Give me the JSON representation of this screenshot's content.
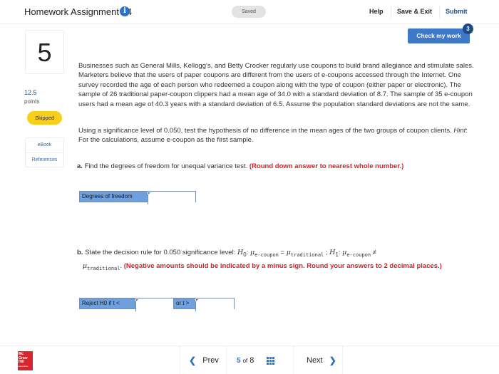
{
  "header": {
    "title": "Homework Assignment #4",
    "info_icon": "i",
    "saved_label": "Saved",
    "help_label": "Help",
    "save_exit_label": "Save & Exit",
    "submit_label": "Submit"
  },
  "check_work": {
    "label": "Check my work",
    "badge_count": "3"
  },
  "question": {
    "number": "5",
    "points_value": "12.5",
    "points_label": "points",
    "status": "Skipped",
    "resources": [
      "eBook",
      "References"
    ]
  },
  "problem": {
    "paragraph1": "Businesses such as General Mills, Kellogg's, and Betty Crocker regularly use coupons to build brand allegiance and stimulate sales. Marketers believe that the users of paper coupons are different from the users of e-coupons accessed through the Internet. One survey recorded the age of each person who redeemed a coupon along with the type of coupon (either paper or electronic). The sample of 26 traditional paper-coupon clippers had a mean age of 34.0 with a standard deviation of 8.7. The sample of 35 e-coupon users had a mean age of 40.3 years with a standard deviation of 6.5. Assume the population standard deviations are not the same.",
    "paragraph2_start": "Using a significance level of 0.050, test the hypothesis of no difference in the mean ages of the two groups of coupon clients. ",
    "hint_label": "Hint",
    "paragraph2_end": ": For the calculations, assume e-coupon as the first sample."
  },
  "part_a": {
    "letter": "a.",
    "text": "Find the degrees of freedom for unequal variance test. ",
    "instruction": "(Round down answer to nearest whole number.)",
    "field_label": "Degrees of freedom",
    "field_value": ""
  },
  "part_b": {
    "letter": "b.",
    "text": "State the decision rule for 0.050 significance level: ",
    "h0": "H",
    "h0_sub": "0",
    "mu": "μ",
    "sub_ecoupon": "e-coupon",
    "sub_traditional": "traditional",
    "eq": " = ",
    "semi": " ; ",
    "h1": "H",
    "h1_sub": "1",
    "neq": " ≠",
    "instruction": "(Negative amounts should be indicated by a minus sign. Round your answers to 2 decimal places.)",
    "label1": "Reject H0 if t <",
    "value1": "",
    "label2": "or t >",
    "value2": ""
  },
  "footer": {
    "logo_lines": [
      "Mc",
      "Graw",
      "Hill",
      "Education"
    ],
    "prev_label": "Prev",
    "current_page": "5",
    "of_label": "of",
    "total_pages": "8",
    "next_label": "Next"
  },
  "colors": {
    "accent": "#3e78c6",
    "badge": "#1e4a87",
    "skipped": "#f7cf1a",
    "instruction_red": "#d3232a",
    "input_label_bg": "#6fa0de",
    "logo_red": "#d7262f"
  }
}
